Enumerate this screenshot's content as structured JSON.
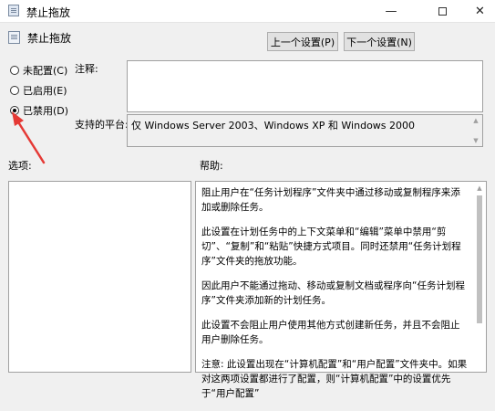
{
  "window": {
    "title": "禁止拖放",
    "minimize": "—",
    "close": "✕"
  },
  "header": {
    "title": "禁止拖放"
  },
  "nav": {
    "prev_label": "上一个设置(P)",
    "next_label": "下一个设置(N)"
  },
  "state": {
    "options": [
      {
        "label": "未配置(C)",
        "checked": false
      },
      {
        "label": "已启用(E)",
        "checked": false
      },
      {
        "label": "已禁用(D)",
        "checked": true
      }
    ]
  },
  "labels": {
    "comment": "注释:",
    "platform": "支持的平台:",
    "options": "选项:",
    "help": "帮助:"
  },
  "comment": {
    "value": ""
  },
  "platform": {
    "value": "仅 Windows Server 2003、Windows XP 和 Windows 2000"
  },
  "help": {
    "paragraphs": [
      "阻止用户在“任务计划程序”文件夹中通过移动或复制程序来添加或删除任务。",
      "此设置在计划任务中的上下文菜单和“编辑”菜单中禁用“剪切”、“复制”和“粘贴”快捷方式项目。同时还禁用“任务计划程序”文件夹的拖放功能。",
      "因此用户不能通过拖动、移动或复制文档或程序向“任务计划程序”文件夹添加新的计划任务。",
      "此设置不会阻止用户使用其他方式创建新任务，并且不会阻止用户删除任务。",
      "注意: 此设置出现在“计算机配置”和“用户配置”文件夹中。如果对这两项设置都进行了配置，则“计算机配置”中的设置优先于“用户配置”"
    ]
  },
  "colors": {
    "annotation_arrow": "#e53935"
  }
}
